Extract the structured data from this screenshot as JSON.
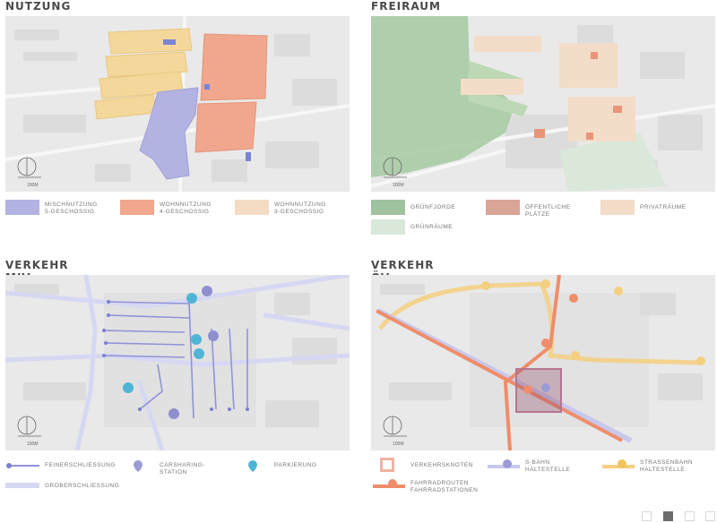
{
  "panels": {
    "nutzung": {
      "title": "NUTZUNG",
      "legend": [
        {
          "label": "MISCHNUTZUNG\n5-GESCHOSSIG",
          "color": "#b3b3e3"
        },
        {
          "label": "WOHNNUTZUNG\n4-GESCHOSSIG",
          "color": "#f0a78e"
        },
        {
          "label": "WOHNNUTZUNG\n3-GESCHOSSIG",
          "color": "#f3dcc3"
        }
      ]
    },
    "freiraum": {
      "title": "FREIRAUM",
      "legend": [
        {
          "label": "GRÜNFJORDE",
          "color": "#9fc29f"
        },
        {
          "label": "ÖFFENTLICHE PLÄTZE",
          "color": "#d9a597"
        },
        {
          "label": "PRIVATRÄUME",
          "color": "#f3dcc8"
        },
        {
          "label": "GRÜNRÄUME",
          "color": "#d9e8d9"
        }
      ]
    },
    "miv": {
      "title": "VERKEHR MIV",
      "legend": [
        {
          "label": "FEINERSCHLIESSUNG",
          "icon": "line-dot-icon"
        },
        {
          "label": "CARSHARING-STATION",
          "icon": "pin-purple-icon"
        },
        {
          "label": "PARKIERUNG",
          "icon": "pin-blue-icon"
        },
        {
          "label": "GROBERSCHLIESSUNG",
          "icon": "line-light-icon"
        }
      ]
    },
    "ov": {
      "title": "VERKEHR ÖV",
      "legend": [
        {
          "label": "VERKEHRSKNOTEN",
          "icon": "square-outline-icon"
        },
        {
          "label": "S-BAHN\nHALTESTELLE",
          "icon": "pin-purple-line-icon"
        },
        {
          "label": "STRASSENBAHN\nHALTESTELLE",
          "icon": "pin-yellow-line-icon"
        },
        {
          "label": "FAHRRADROUTEN\nFAHRRADSTATIONEN",
          "icon": "pin-orange-line-icon"
        }
      ]
    }
  },
  "scale_label": "100M",
  "pager": {
    "count": 4,
    "active": 1
  }
}
